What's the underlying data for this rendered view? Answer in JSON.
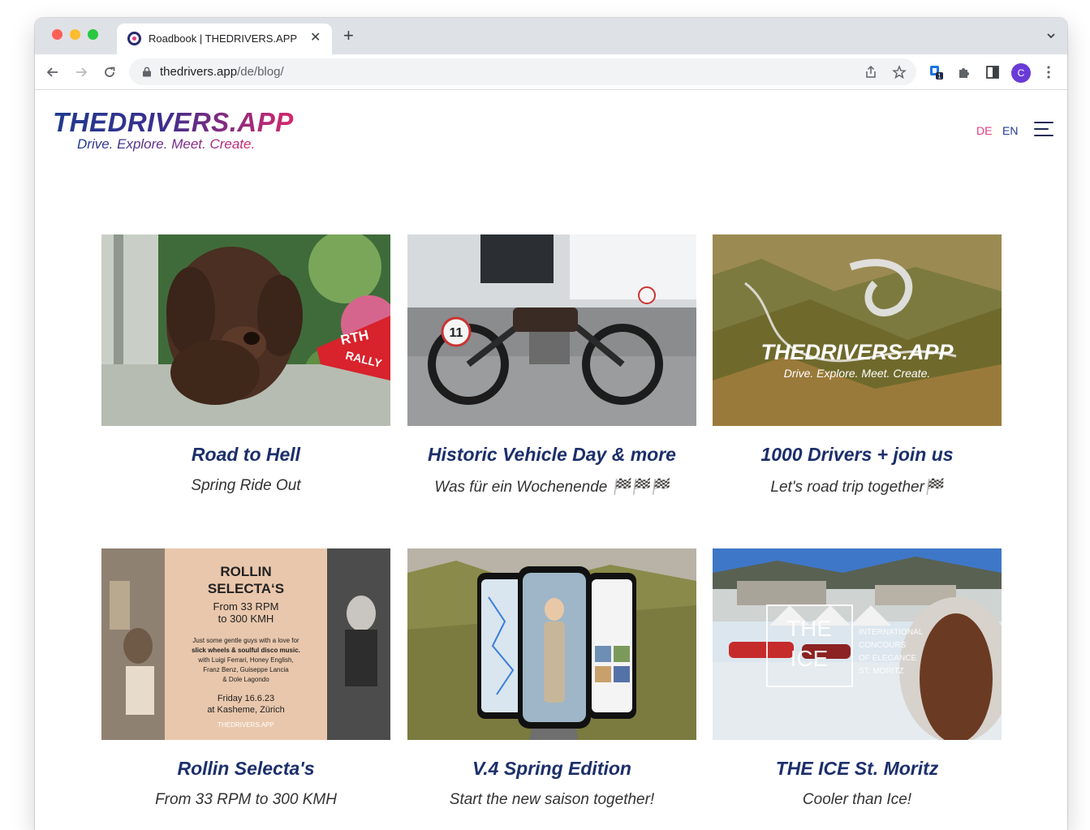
{
  "browser": {
    "tab_title": "Roadbook | THEDRIVERS.APP",
    "url_host": "thedrivers.app",
    "url_path": "/de/blog/",
    "profile_initial": "C",
    "extension_badge": "1"
  },
  "site": {
    "logo_text": "THEDRIVERS.APP",
    "tagline": "Drive. Explore. Meet. Create.",
    "lang_de": "DE",
    "lang_en": "EN",
    "accent_pink": "#e23d7d",
    "accent_navy": "#1c2f6b"
  },
  "cards": [
    {
      "title": "Road to Hell",
      "subtitle": "Spring Ride Out",
      "image": "dog-rally-photo",
      "image_text": [
        "RTH",
        "RALLY"
      ]
    },
    {
      "title": "Historic Vehicle Day & more",
      "subtitle": "Was für ein Wochenende 🏁🏁🏁",
      "image": "vintage-motorcycle-photo",
      "image_text": [
        "11"
      ]
    },
    {
      "title": "1000 Drivers + join us",
      "subtitle": "Let's road trip together🏁",
      "image": "mountain-road-logo-photo",
      "image_text": [
        "THEDRIVERS.APP",
        "Drive. Explore. Meet. Create."
      ]
    },
    {
      "title": "Rollin Selecta's",
      "subtitle": "From 33 RPM to 300 KMH",
      "image": "poster-collage",
      "poster": {
        "heading": "ROLLIN SELECTA'S",
        "line1": "From 33 RPM",
        "line2": "to 300 KMH",
        "body1": "Just some gentle guys with a love for",
        "body2": "slick wheels & soulful disco music.",
        "body3": "with Luigi Ferrari, Honey English,",
        "body4": "Franz Benz, Guiseppe Lancia",
        "body5": "& Dole Lagondo",
        "date": "Friday 16.6.23",
        "venue": "at Kasheme, Zürich",
        "brand": "THEDRIVERS.APP"
      }
    },
    {
      "title": "V.4 Spring Edition",
      "subtitle": "Start the new saison together!",
      "image": "phones-app-screens"
    },
    {
      "title": "THE ICE St. Moritz",
      "subtitle": "Cooler than Ice!",
      "image": "st-moritz-event-photo",
      "image_text": [
        "THE",
        "ICE",
        "INTERNATIONAL",
        "CONCOURS",
        "OF ELEGANCE",
        "ST. MORITZ"
      ]
    }
  ]
}
